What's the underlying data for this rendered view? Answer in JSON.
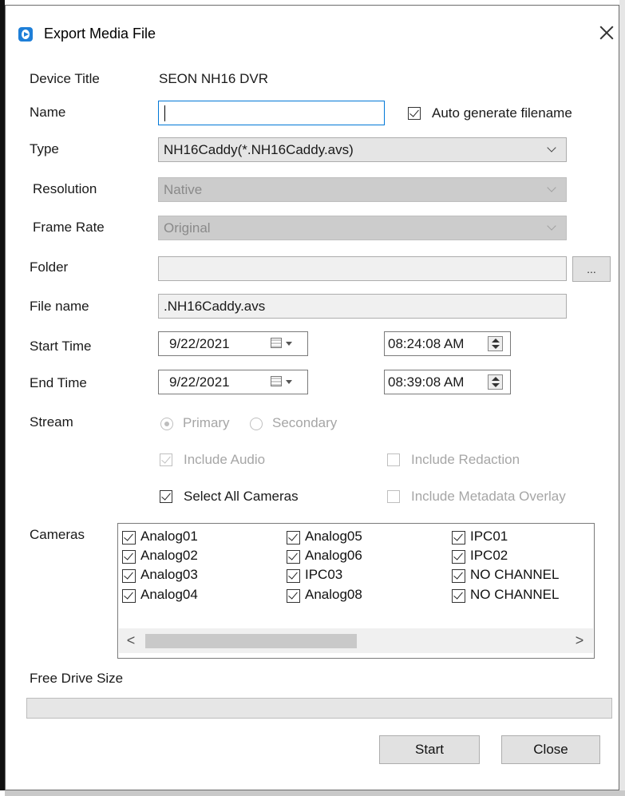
{
  "window": {
    "title": "Export Media File"
  },
  "labels": {
    "device_title": "Device Title",
    "name": "Name",
    "type": "Type",
    "resolution": "Resolution",
    "frame_rate": "Frame Rate",
    "folder": "Folder",
    "file_name": "File name",
    "start_time": "Start Time",
    "end_time": "End Time",
    "stream": "Stream",
    "cameras": "Cameras",
    "free_drive_size": "Free Drive Size"
  },
  "device_title_value": "SEON NH16 DVR",
  "name_field": {
    "value": ""
  },
  "auto_generate": {
    "label": "Auto generate filename",
    "checked": true
  },
  "type_select": {
    "value": "NH16Caddy(*.NH16Caddy.avs)"
  },
  "resolution_select": {
    "value": "Native",
    "disabled": true
  },
  "frame_rate_select": {
    "value": "Original",
    "disabled": true
  },
  "folder_field": {
    "value": "",
    "browse_label": "..."
  },
  "file_name_field": {
    "value": ".NH16Caddy.avs"
  },
  "start": {
    "date": "9/22/2021",
    "time": "08:24:08 AM"
  },
  "end": {
    "date": "9/22/2021",
    "time": "08:39:08 AM"
  },
  "stream": {
    "options": [
      {
        "label": "Primary",
        "selected": true
      },
      {
        "label": "Secondary",
        "selected": false
      }
    ],
    "disabled": true
  },
  "options": {
    "include_audio": {
      "label": "Include Audio",
      "checked": true,
      "disabled": true
    },
    "include_redaction": {
      "label": "Include Redaction",
      "checked": false,
      "disabled": true
    },
    "select_all_cameras": {
      "label": "Select All Cameras",
      "checked": true,
      "disabled": false
    },
    "include_metadata_overlay": {
      "label": "Include Metadata Overlay",
      "checked": false,
      "disabled": true
    }
  },
  "cameras": [
    [
      {
        "label": "Analog01",
        "checked": true
      },
      {
        "label": "Analog02",
        "checked": true
      },
      {
        "label": "Analog03",
        "checked": true
      },
      {
        "label": "Analog04",
        "checked": true
      }
    ],
    [
      {
        "label": "Analog05",
        "checked": true
      },
      {
        "label": "Analog06",
        "checked": true
      },
      {
        "label": "IPC03",
        "checked": true
      },
      {
        "label": "Analog08",
        "checked": true
      }
    ],
    [
      {
        "label": "IPC01",
        "checked": true
      },
      {
        "label": "IPC02",
        "checked": true
      },
      {
        "label": "NO CHANNEL",
        "checked": true
      },
      {
        "label": "NO CHANNEL",
        "checked": true
      }
    ]
  ],
  "scrollbar": {
    "left_arrow": "<",
    "right_arrow": ">"
  },
  "drive": {
    "fill_fraction": 0
  },
  "buttons": {
    "start": "Start",
    "close": "Close"
  }
}
